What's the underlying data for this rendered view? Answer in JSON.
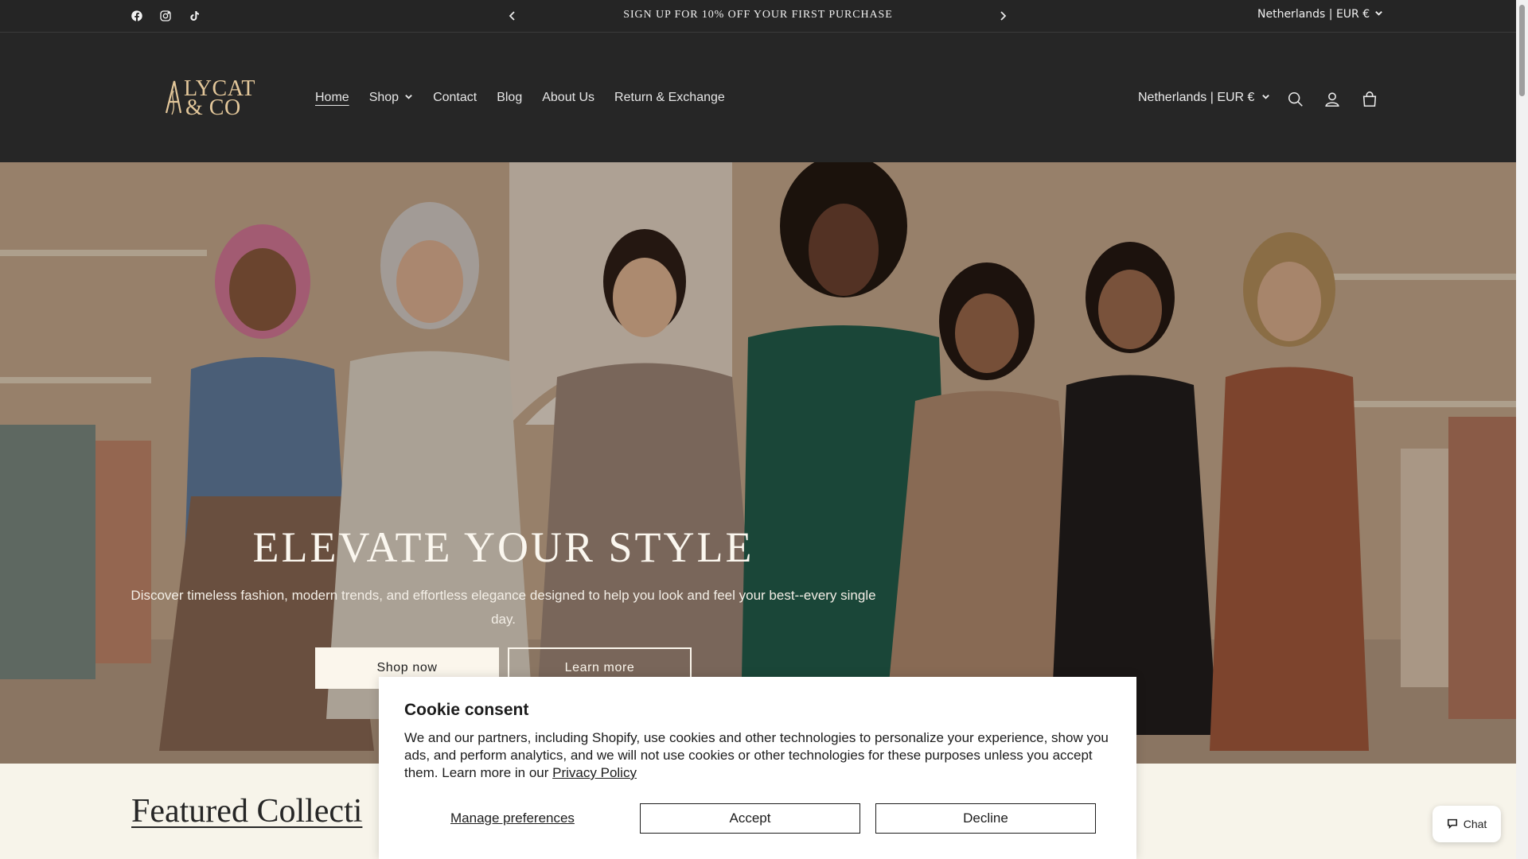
{
  "announcement": {
    "social": [
      "facebook-icon",
      "instagram-icon",
      "tiktok-icon"
    ],
    "prev_icon": "chevron-left-icon",
    "next_icon": "chevron-right-icon",
    "message": "SIGN UP FOR 10% OFF YOUR FIRST PURCHASE",
    "locale": "Netherlands | EUR €"
  },
  "header": {
    "logo_line1": "LYCAT",
    "logo_line2": "& CO",
    "nav": [
      {
        "label": "Home",
        "active": true
      },
      {
        "label": "Shop",
        "has_dropdown": true
      },
      {
        "label": "Contact"
      },
      {
        "label": "Blog"
      },
      {
        "label": "About Us"
      },
      {
        "label": "Return & Exchange"
      }
    ],
    "locale": "Netherlands | EUR €",
    "icons": [
      "search-icon",
      "account-icon",
      "cart-icon"
    ]
  },
  "hero": {
    "title": "ELEVATE YOUR STYLE",
    "subtitle": "Discover timeless fashion, modern trends, and effortless elegance designed to help you look and feel your best--every single day.",
    "primary_button": "Shop now",
    "secondary_button": "Learn more"
  },
  "featured": {
    "title": "Featured Collecti"
  },
  "cookie": {
    "title": "Cookie consent",
    "body": "We and our partners, including Shopify, use cookies and other technologies to personalize your experience, show you ads, and perform analytics, and we will not use cookies or other technologies for these purposes unless you accept them. Learn more in our ",
    "link": "Privacy Policy",
    "manage": "Manage preferences",
    "accept": "Accept",
    "decline": "Decline"
  },
  "chat": {
    "label": "Chat",
    "icon": "chat-bubble-icon"
  },
  "colors": {
    "bar_bg": "#252525",
    "header_bg": "#262626",
    "page_bg": "#f7f4ea",
    "logo_gold": "#e3c79a"
  }
}
